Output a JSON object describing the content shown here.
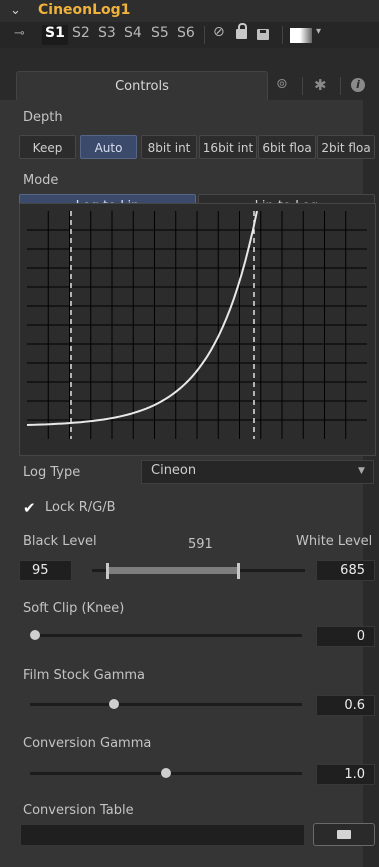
{
  "tool": {
    "name": "CineonLog1",
    "chevron_icon": "chevron-down"
  },
  "version_slots": [
    "S1",
    "S2",
    "S3",
    "S4",
    "S5",
    "S6"
  ],
  "active_slot": "S1",
  "tabs": {
    "controls_label": "Controls",
    "icons": [
      "link-icon",
      "gear-icon",
      "info-icon"
    ]
  },
  "depth": {
    "label": "Depth",
    "options": [
      "Keep",
      "Auto",
      "8bit int",
      "16bit int",
      "6bit floa",
      "2bit floa"
    ],
    "selected": "Auto"
  },
  "mode": {
    "label": "Mode",
    "options": [
      "Log to Lin",
      "Lin to Log"
    ],
    "selected": "Log to Lin"
  },
  "log_type": {
    "label": "Log Type",
    "value": "Cineon"
  },
  "lock_rgb": {
    "label": "Lock R/G/B",
    "checked": true
  },
  "levels": {
    "black_label": "Black Level",
    "white_label": "White Level",
    "mid_value": "591",
    "black_value": "95",
    "white_value": "685"
  },
  "soft_clip": {
    "label": "Soft Clip (Knee)",
    "value": "0",
    "fraction": 0.0
  },
  "film_stock_gamma": {
    "label": "Film Stock Gamma",
    "value": "0.6",
    "fraction": 0.3
  },
  "conversion_gamma": {
    "label": "Conversion Gamma",
    "value": "1.0",
    "fraction": 0.5
  },
  "conversion_table": {
    "label": "Conversion Table",
    "path": ""
  },
  "colors": {
    "title": "#f0b23a",
    "selected_button": "#3b4a6b",
    "curve": "#e8e8e8",
    "grid": "#000000"
  }
}
